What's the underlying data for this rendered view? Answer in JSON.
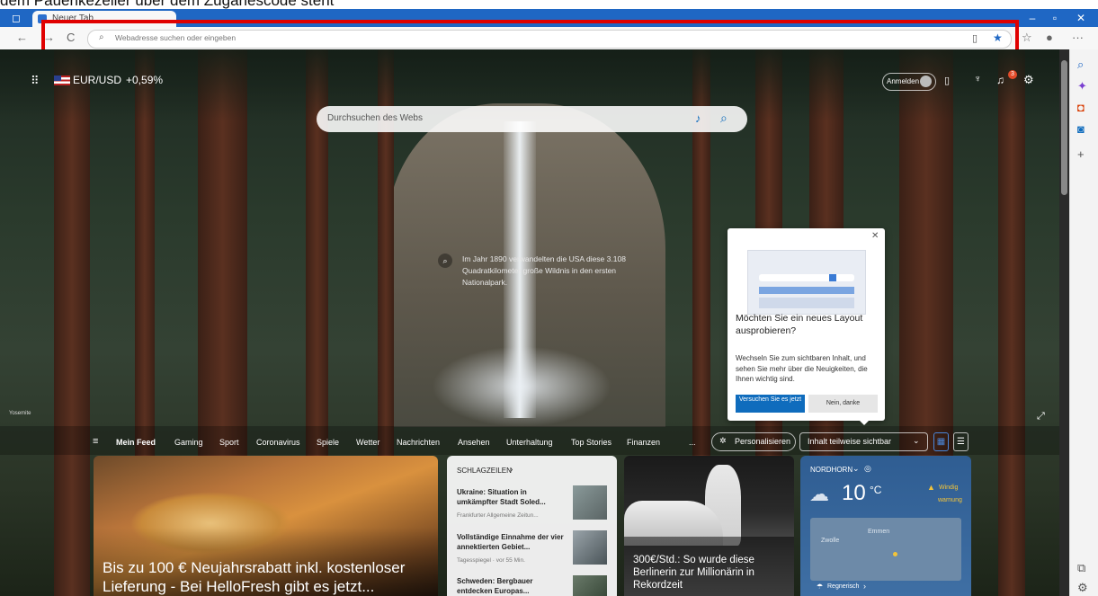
{
  "caption": {
    "text": "dem Pauenkezeller über dem Zuganescode steht"
  },
  "browser": {
    "tab_title": "Neuer Tab",
    "address_placeholder": "Webadresse suchen oder eingeben"
  },
  "header": {
    "ticker_label": "EUR/USD",
    "ticker_value": "+0,59%",
    "signin_label": "Anmelden",
    "notification_count": "3"
  },
  "search": {
    "placeholder": "Durchsuchen des Webs"
  },
  "image_caption": "Im Jahr 1890 verwandelten die USA diese 3.108 Quadratkilometer große Wildnis in den ersten Nationalpark.",
  "image_credit": "Yosemite",
  "nav": {
    "items": [
      "Mein Feed",
      "Gaming",
      "Sport",
      "Coronavirus",
      "Spiele",
      "Wetter",
      "Nachrichten",
      "Ansehen",
      "Unterhaltung",
      "Top Stories",
      "Finanzen"
    ],
    "more": "...",
    "personalize_label": "Personalisieren",
    "content_select": "Inhalt teilweise sichtbar"
  },
  "popup": {
    "title": "Möchten Sie ein neues Layout ausprobieren?",
    "body": "Wechseln Sie zum sichtbaren Inhalt, und sehen Sie mehr über die Neuigkeiten, die Ihnen wichtig sind.",
    "primary_label": "Versuchen Sie es jetzt",
    "secondary_label": "Nein, danke"
  },
  "cards": {
    "hero_title": "Bis zu 100 € Neujahrsrabatt inkl. kostenloser Lieferung - Bei HelloFresh gibt es jetzt...",
    "headlines_title": "SCHLAGZEILEN",
    "headlines": [
      {
        "title": "Ukraine: Situation in umkämpfter Stadt Soled...",
        "source": "Frankfurter Allgemeine Zeitun..."
      },
      {
        "title": "Vollständige Einnahme der vier annektierten Gebiet...",
        "source": "Tagesspiegel · vor 55 Min."
      },
      {
        "title": "Schweden: Bergbauer entdecken Europas...",
        "source": ""
      }
    ],
    "promo_title": "300€/Std.: So wurde diese Berlinerin zur Millionärin in Rekordzeit",
    "weather": {
      "location": "NORDHORN",
      "temp": "10",
      "unit": "°C",
      "warning": "Windig",
      "warning_sub": "warnung",
      "map_label": "Zwolle",
      "map_label2": "Emmen",
      "link": "Regnerisch"
    }
  },
  "colors": {
    "accent": "#1f67c4",
    "highlight_box": "#e00000",
    "primary_button": "#0f6cbd"
  }
}
